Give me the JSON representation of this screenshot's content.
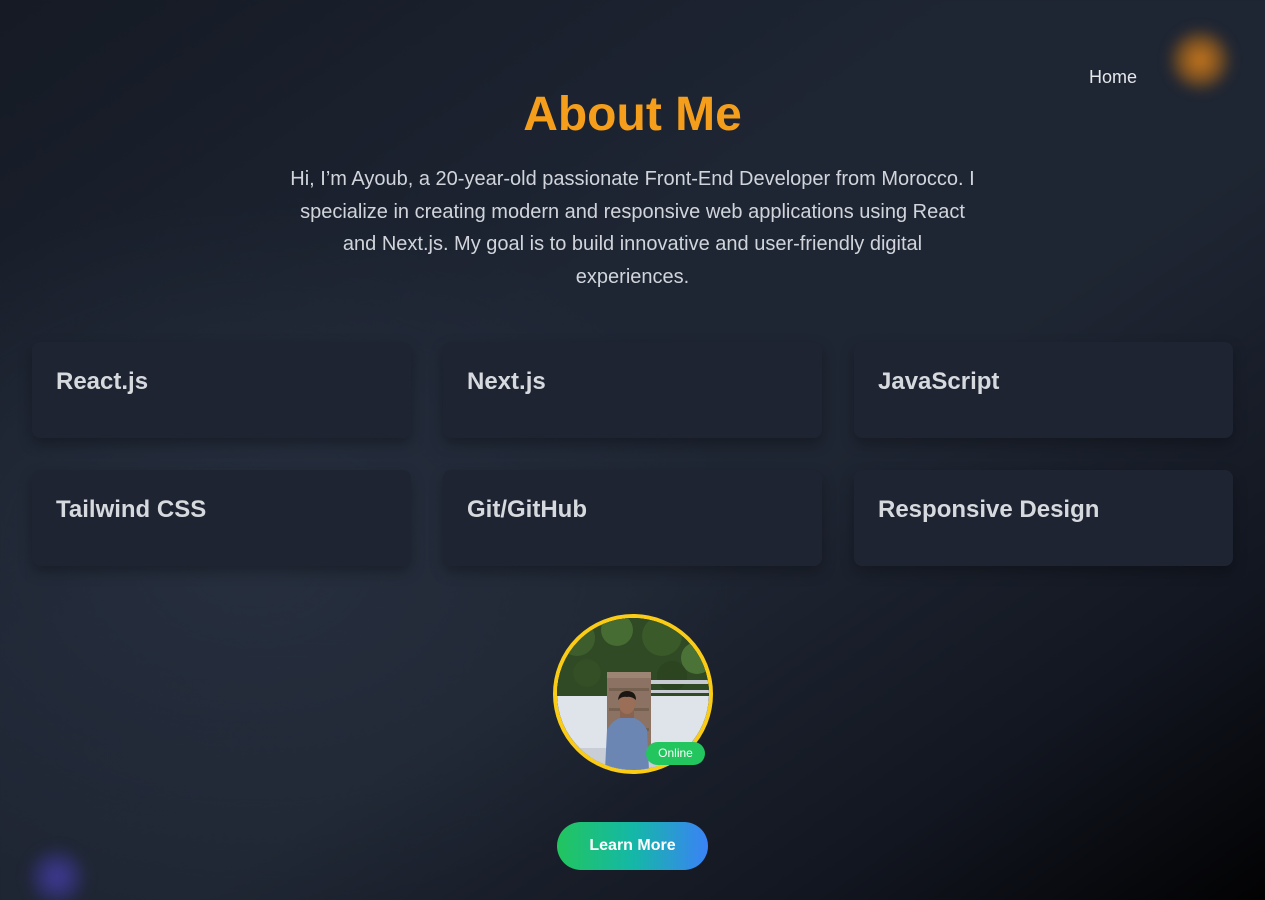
{
  "nav": {
    "home_label": "Home"
  },
  "about": {
    "title": "About Me",
    "intro": "Hi, I’m Ayoub, a 20-year-old passionate Front-End Developer from Morocco. I specialize in creating modern and responsive web applications using React and Next.js. My goal is to build innovative and user-friendly digital experiences."
  },
  "skills": [
    {
      "label": "React.js"
    },
    {
      "label": "Next.js"
    },
    {
      "label": "JavaScript"
    },
    {
      "label": "Tailwind CSS"
    },
    {
      "label": "Git/GitHub"
    },
    {
      "label": "Responsive Design"
    }
  ],
  "profile": {
    "status": "Online"
  },
  "cta": {
    "label": "Learn More"
  },
  "colors": {
    "accent_title": "#f59e1b",
    "avatar_ring": "#facc15",
    "status_online": "#22c55e",
    "button_gradient_start": "#22c55e",
    "button_gradient_end": "#3b82f6"
  }
}
